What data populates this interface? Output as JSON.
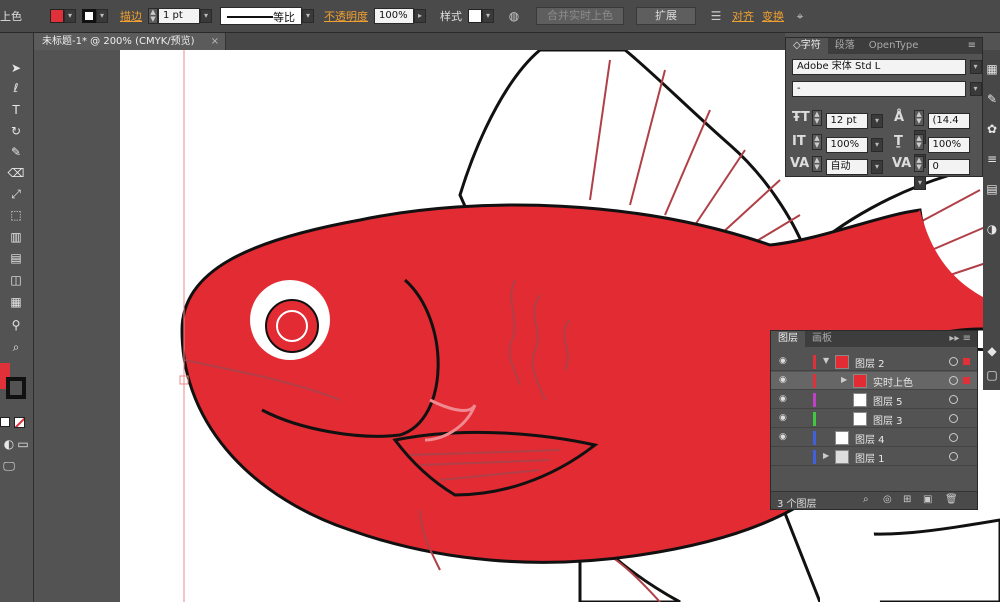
{
  "control_bar": {
    "label_fill": "上色",
    "label_stroke": "描边",
    "stroke_weight": "1 pt",
    "stroke_profile": "等比",
    "label_opacity": "不透明度",
    "opacity_value": "100%",
    "label_style": "样式",
    "button_merge": "合并实时上色",
    "button_expand": "扩展",
    "label_align": "对齐",
    "label_transform": "变换"
  },
  "document": {
    "tab_title": "未标题-1* @ 200% (CMYK/预览)",
    "close_glyph": "×"
  },
  "character_panel": {
    "tabs": [
      "◇字符",
      "段落",
      "OpenType"
    ],
    "font_family": "Adobe 宋体 Std L",
    "font_style": "-",
    "font_size": "12 pt",
    "leading": "(14.4",
    "horizontal_scale": "100%",
    "vertical_scale": "100%",
    "kerning": "自动",
    "tracking": "0"
  },
  "layers_panel": {
    "tabs": [
      "图层",
      "画板"
    ],
    "layers": [
      {
        "name": "图层 2",
        "color": "#e0303a",
        "expanded": true,
        "selected": false
      },
      {
        "name": "实时上色",
        "color": "#e0303a",
        "selected": true
      },
      {
        "name": "图层 5",
        "color": "#c040c8",
        "selected": false
      },
      {
        "name": "图层 3",
        "color": "#40c840",
        "selected": false
      },
      {
        "name": "图层 4",
        "color": "#4060e0",
        "selected": false
      },
      {
        "name": "图层 1",
        "color": "#4060e0",
        "selected": false
      }
    ],
    "footer_count": "3 个图层"
  },
  "colors": {
    "fill": "#e0303a",
    "fish_body": "#e22b33",
    "accent_orange": "#f0a030"
  }
}
